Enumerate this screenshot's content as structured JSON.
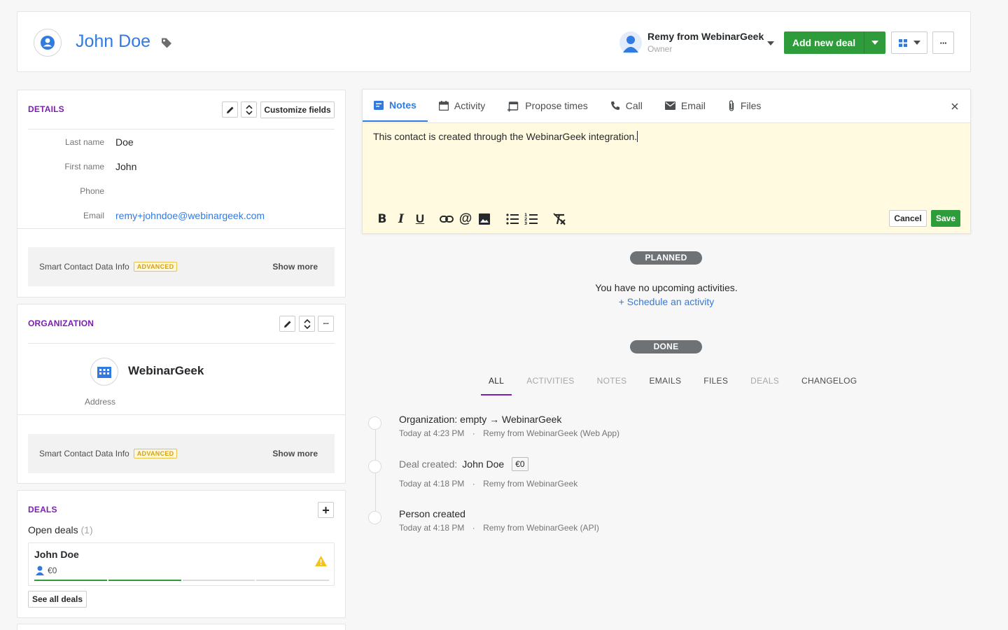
{
  "header": {
    "person_name": "John Doe",
    "owner_name": "Remy from WebinarGeek",
    "owner_role": "Owner",
    "add_deal_label": "Add new deal",
    "more_label": "···"
  },
  "details": {
    "title": "DETAILS",
    "customize_label": "Customize fields",
    "fields": [
      {
        "label": "Last name",
        "value": "Doe"
      },
      {
        "label": "First name",
        "value": "John"
      },
      {
        "label": "Phone",
        "value": ""
      },
      {
        "label": "Email",
        "value": "remy+johndoe@webinargeek.com"
      }
    ],
    "smart_info_label": "Smart Contact Data Info",
    "advanced_badge": "ADVANCED",
    "show_more_label": "Show more"
  },
  "organization": {
    "title": "ORGANIZATION",
    "name": "WebinarGeek",
    "address_label": "Address",
    "smart_info_label": "Smart Contact Data Info",
    "advanced_badge": "ADVANCED",
    "show_more_label": "Show more"
  },
  "deals": {
    "title": "DEALS",
    "open_deals_label": "Open deals",
    "open_deals_count": "(1)",
    "deal_name": "John Doe",
    "deal_value": "€0",
    "see_all_label": "See all deals",
    "stage_progress": 0.5
  },
  "editor": {
    "tabs": [
      {
        "label": "Notes",
        "icon": "note-icon"
      },
      {
        "label": "Activity",
        "icon": "calendar-icon"
      },
      {
        "label": "Propose times",
        "icon": "propose-times-icon"
      },
      {
        "label": "Call",
        "icon": "phone-icon"
      },
      {
        "label": "Email",
        "icon": "mail-icon"
      },
      {
        "label": "Files",
        "icon": "paperclip-icon"
      }
    ],
    "note_text": "This contact is created through the WebinarGeek integration.",
    "cancel_label": "Cancel",
    "save_label": "Save"
  },
  "planned": {
    "pill": "PLANNED",
    "empty_text": "You have no upcoming activities.",
    "schedule_link": "+ Schedule an activity"
  },
  "done": {
    "pill": "DONE",
    "filters": [
      "ALL",
      "ACTIVITIES",
      "NOTES",
      "EMAILS",
      "FILES",
      "DEALS",
      "CHANGELOG"
    ],
    "items": [
      {
        "title": "Organization: empty → WebinarGeek",
        "time": "Today at 4:23 PM",
        "sep": "·",
        "source": "Remy from WebinarGeek (Web App)"
      },
      {
        "prefix": "Deal created:",
        "title": "John Doe",
        "badge": "€0",
        "time": "Today at 4:18 PM",
        "sep": "·",
        "source": "Remy from WebinarGeek"
      },
      {
        "title": "Person created",
        "time": "Today at 4:18 PM",
        "sep": "·",
        "source": "Remy from WebinarGeek (API)"
      }
    ]
  },
  "colors": {
    "accent": "#317ae2",
    "section": "#7a1fb1",
    "save_green": "#2f9c3c",
    "note_bg": "#fffae0",
    "warning": "#f5c21b"
  }
}
